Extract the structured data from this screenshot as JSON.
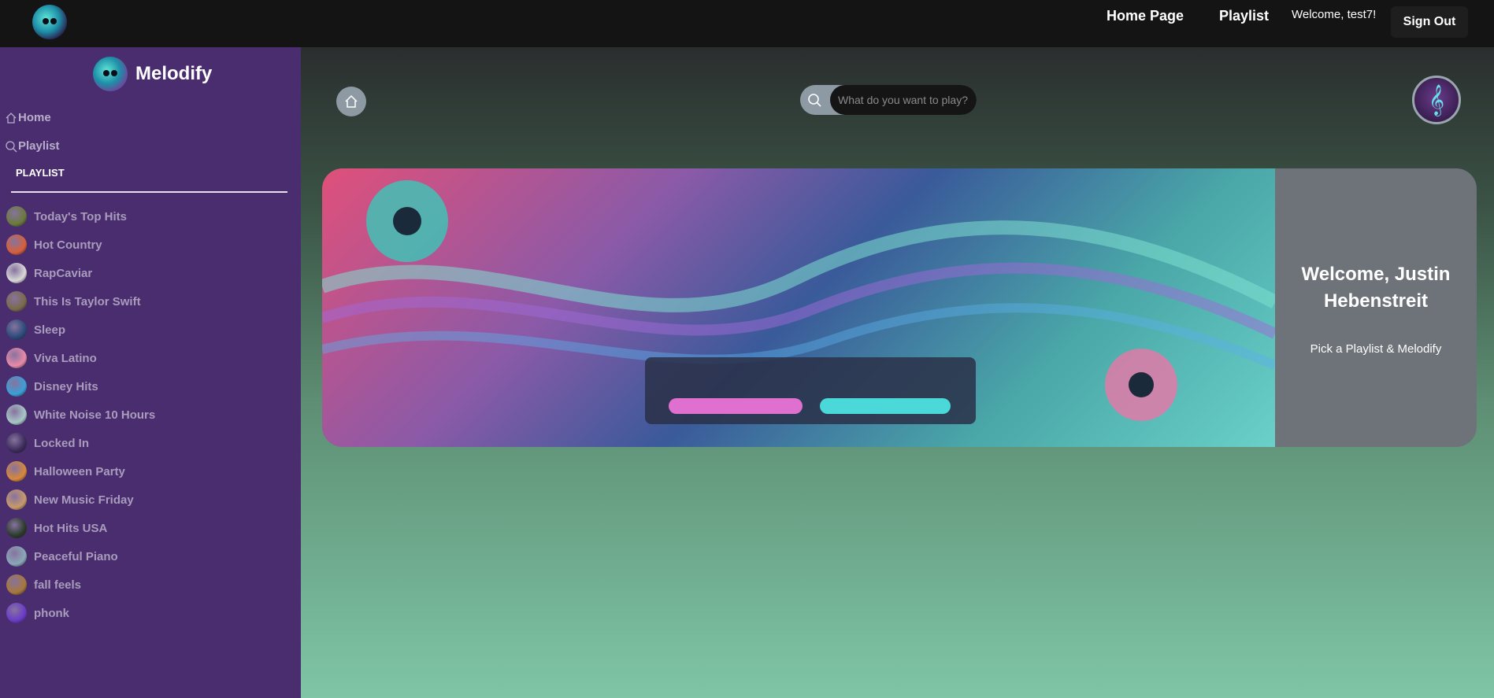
{
  "topbar": {
    "nav": [
      "Home Page",
      "Playlist"
    ],
    "welcome": "Welcome, test7!",
    "signout_label": "Sign Out"
  },
  "sidebar": {
    "brand": "Melodify",
    "nav": [
      {
        "label": "Home",
        "icon": "home-icon"
      },
      {
        "label": "Playlist",
        "icon": "search-icon"
      }
    ],
    "playlist_heading": "PLAYLIST",
    "playlists": [
      {
        "name": "Today's Top Hits",
        "color": "#6a7a3a"
      },
      {
        "name": "Hot Country",
        "color": "#d8603a"
      },
      {
        "name": "RapCaviar",
        "color": "#d8d8d8"
      },
      {
        "name": "This Is Taylor Swift",
        "color": "#7a6a4a"
      },
      {
        "name": "Sleep",
        "color": "#2a4a7a"
      },
      {
        "name": "Viva Latino",
        "color": "#e88aa8"
      },
      {
        "name": "Disney Hits",
        "color": "#3aa0d8"
      },
      {
        "name": "White Noise 10 Hours",
        "color": "#a8c8c8"
      },
      {
        "name": "Locked In",
        "color": "#3a2a5a"
      },
      {
        "name": "Halloween Party",
        "color": "#d8883a"
      },
      {
        "name": "New Music Friday",
        "color": "#c89a6a"
      },
      {
        "name": "Hot Hits USA",
        "color": "#2a3a2a"
      },
      {
        "name": "Peaceful Piano",
        "color": "#8aa8b8"
      },
      {
        "name": "fall feels",
        "color": "#a8783a"
      },
      {
        "name": "phonk",
        "color": "#6a3ac8"
      }
    ]
  },
  "main": {
    "search_placeholder": "What do you want to play?",
    "hero_title": "Welcome, Justin Hebenstreit",
    "hero_sub": "Pick a Playlist & Melodify"
  },
  "colors": {
    "sidebar": "#4a2d6e",
    "topbar": "#141414",
    "accent": "#7fc5a6"
  }
}
